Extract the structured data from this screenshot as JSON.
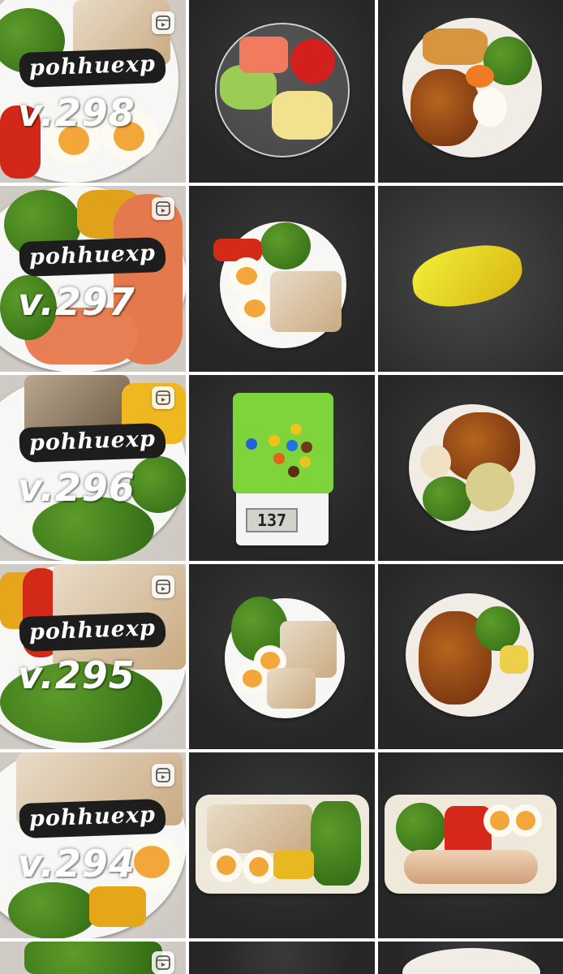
{
  "grid": {
    "brand_text": "pohhuexp",
    "posts": [
      {
        "version": "v.298"
      },
      {
        "version": "v.297"
      },
      {
        "version": "v.296"
      },
      {
        "version": "v.295"
      },
      {
        "version": "v.294"
      }
    ],
    "scale_display": "137"
  },
  "icons": {
    "reel": "reels-icon"
  }
}
